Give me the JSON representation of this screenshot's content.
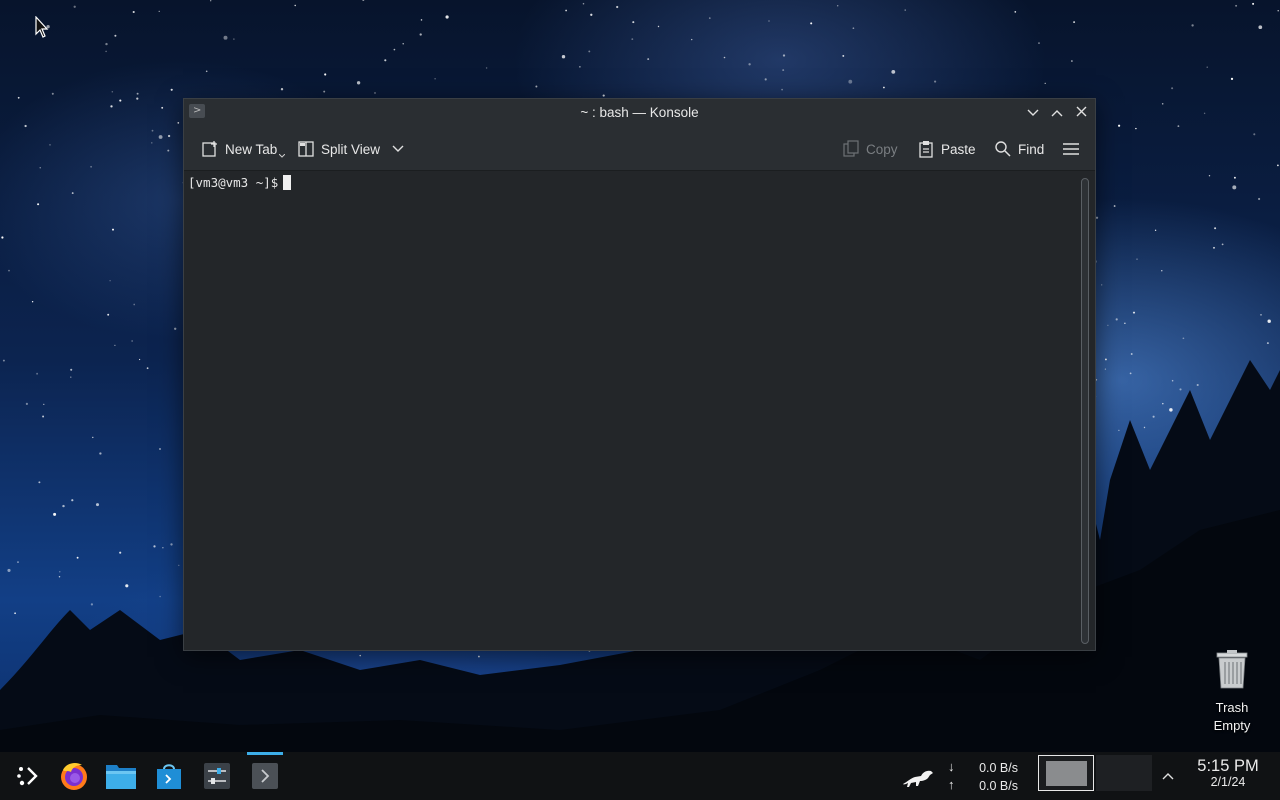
{
  "window": {
    "title": "~ : bash — Konsole",
    "toolbar": {
      "new_tab": "New Tab",
      "split_view": "Split View",
      "copy": "Copy",
      "paste": "Paste",
      "find": "Find"
    },
    "terminal": {
      "prompt": "[vm3@vm3 ~]$"
    }
  },
  "desktop": {
    "trash": {
      "line1": "Trash",
      "line2": "Empty"
    }
  },
  "taskbar": {
    "tasks": [
      "application-launcher-icon",
      "firefox-icon",
      "file-manager-icon",
      "discover-store-icon",
      "system-settings-icon",
      "konsole-icon"
    ],
    "network": {
      "download": "0.0 B/s",
      "upload": "0.0 B/s",
      "down_arrow": "↓",
      "up_arrow": "↑"
    },
    "clock": {
      "time": "5:15 PM",
      "date": "2/1/24"
    }
  },
  "colors": {
    "accent": "#3daee9",
    "window_bg": "#232629",
    "titlebar_bg": "#2a2e32",
    "taskbar_bg": "#101214"
  }
}
